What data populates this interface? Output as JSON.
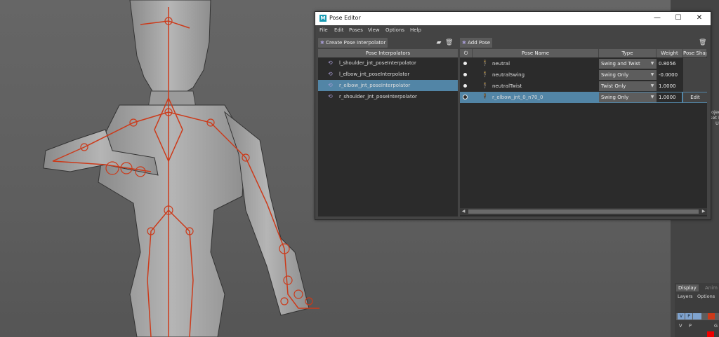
{
  "window": {
    "title": "Pose Editor",
    "logo_letter": "M",
    "minimize": "—",
    "maximize": "☐",
    "close": "✕"
  },
  "menu": [
    "File",
    "Edit",
    "Poses",
    "View",
    "Options",
    "Help"
  ],
  "left": {
    "create_button": "Create Pose Interpolator",
    "header": "Pose Interpolators",
    "items": [
      {
        "label": "l_shoulder_jnt_poseInterpolator",
        "selected": false
      },
      {
        "label": "l_elbow_jnt_poseInterpolator",
        "selected": false
      },
      {
        "label": "r_elbow_jnt_poseInterpolator",
        "selected": true
      },
      {
        "label": "r_shoulder_jnt_poseInterpolator",
        "selected": false
      }
    ]
  },
  "right": {
    "add_button": "Add Pose",
    "headers": {
      "power": "⏻",
      "name": "Pose Name",
      "type": "Type",
      "weight": "Weight",
      "shape": "Pose Shap"
    },
    "poses": [
      {
        "name": "neutral",
        "type": "Swing and Twist",
        "weight": "0.8056",
        "edit": ""
      },
      {
        "name": "neutralSwing",
        "type": "Swing Only",
        "weight": "-0.0000",
        "edit": ""
      },
      {
        "name": "neutralTwist",
        "type": "Twist Only",
        "weight": "1.0000",
        "edit": ""
      },
      {
        "name": "r_elbow_jnt_0_n70_0",
        "type": "Swing Only",
        "weight": "1.0000",
        "edit": "Edit"
      }
    ]
  },
  "side": {
    "fragment1": "oject",
    "fragment2": "set R",
    "fragment3": "U",
    "tab_display": "Display",
    "tab_anim": "Anim",
    "menu_layers": "Layers",
    "menu_options": "Options",
    "layer_v": "V",
    "layer_p": "P",
    "layer_v2": "V",
    "layer_p2": "P",
    "layer_g": "G"
  },
  "colors": {
    "selection": "#5285a6",
    "joint": "#cc3a1a",
    "window_bg": "#444444"
  }
}
